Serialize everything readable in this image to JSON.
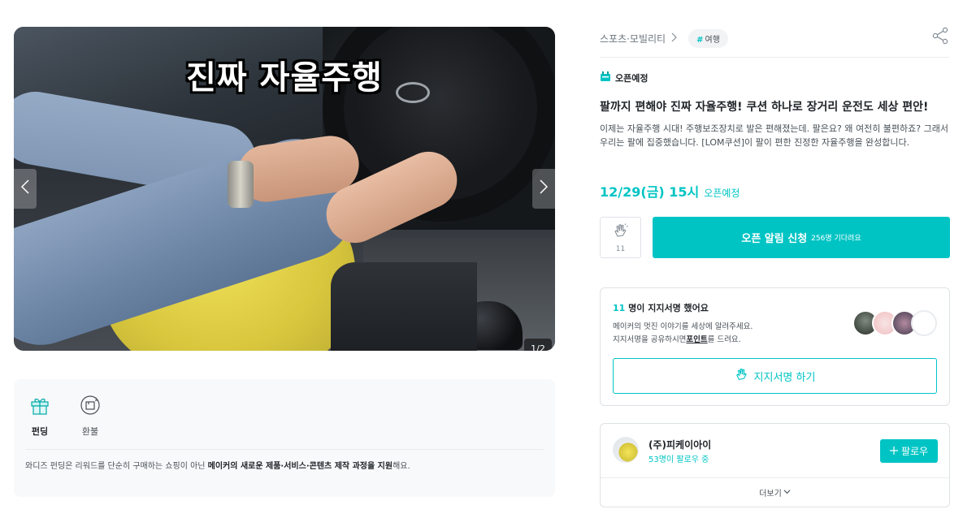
{
  "media": {
    "video_caption": "진짜 자율주행",
    "counter": "1/2",
    "prev_icon": "chevron-left-icon",
    "next_icon": "chevron-right-icon"
  },
  "info_card": {
    "types": [
      {
        "label": "펀딩",
        "icon": "gift-icon",
        "active": true
      },
      {
        "label": "환불",
        "icon": "refund-icon",
        "active": false
      }
    ],
    "description_prefix": "와디즈 펀딩은 리워드를 단순히 구매하는 쇼핑이 아닌 ",
    "description_bold": "메이커의 새로운 제품·서비스·콘텐츠 제작 과정을 지원",
    "description_suffix": "해요."
  },
  "header": {
    "category": "스포츠·모빌리티",
    "tag": "여행",
    "share_icon": "share-icon"
  },
  "project": {
    "status": "오픈예정",
    "title": "팔까지 편해야 진짜 자율주행! 쿠션 하나로 장거리 운전도 세상 편안!",
    "summary": "이제는 자율주행 시대! 주행보조장치로 발은 편해졌는데. 팔은요? 왜 여전히 불편하죠? 그래서 우리는 팔에 집중했습니다. [LOM쿠션]이 팔이 편한 진정한 자율주행을 완성합니다.",
    "open_date": "12/29(금) 15시",
    "open_label": "오픈예정"
  },
  "actions": {
    "clap_count": "11",
    "cta_main": "오픈 알림 신청",
    "cta_sub": "256명 기다려요"
  },
  "support": {
    "count": "11",
    "title_suffix": " 명이 지지서명 했어요",
    "desc_line1": "메이커의 멋진 이야기를 세상에 알려주세요.",
    "desc_line2_prefix": "지지서명을 공유하시면",
    "desc_line2_bold": "포인트",
    "desc_line2_suffix": "를 드려요.",
    "button_label": "지지서명 하기"
  },
  "maker": {
    "name": "(주)피케이아이",
    "followers": "53명이 팔로우 중",
    "follow_label": "팔로우",
    "more_label": "더보기"
  },
  "colors": {
    "accent": "#00c4c4",
    "text": "#212529",
    "muted": "#495057"
  }
}
